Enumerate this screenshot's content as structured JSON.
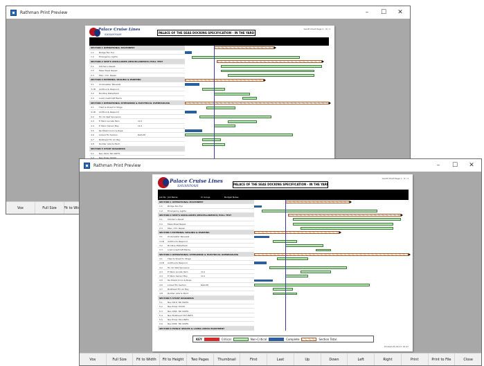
{
  "back_window": {
    "title": "Rathman Print Preview",
    "report_title": "PALACE OF THE SEAS  DOCKING SPECIFICATION - IN THE YARD",
    "page_label": "Gantt Chart Page 1 : 6 / 1",
    "buttons": [
      "Vox",
      "Full Size",
      "Fit to Width"
    ]
  },
  "front_window": {
    "title": "Rathman Print Preview",
    "report_title": "PALACE OF THE SEAS  DOCKING SPECIFICATION - IN THE YARD",
    "page_label": "Gantt Chart Page 1 : 6 / 1",
    "footer_page": "Printed 25-09-17  15:47",
    "buttons": [
      "Vox",
      "Full Size",
      "Fit to Width",
      "Fit to Height",
      "Two Pages",
      "Thumbnail",
      "First",
      "Last",
      "Up",
      "Down",
      "Left",
      "Right",
      "Print",
      "Print to File",
      "Close"
    ]
  },
  "window_controls": {
    "minimize": "–",
    "maximize": "☐",
    "close": "✕"
  },
  "logo": {
    "name": "Palace Cruise Lines",
    "sub": "SAVANNAH"
  },
  "columns": [
    "Job No",
    "Job Name",
    "Cr Group",
    "Budget Notes"
  ],
  "legend": {
    "key_label": "KEY",
    "items": [
      "Critical",
      "Non-Critical",
      "Complete",
      "Section Total"
    ]
  },
  "rows": [
    {
      "type": "sect",
      "no": "",
      "name": "SECTION 1 OPERATIONAL MACHINERY",
      "grp": ""
    },
    {
      "type": "row",
      "no": "1.1",
      "name": "Bridge Fan Fun",
      "grp": ""
    },
    {
      "type": "row",
      "no": "1.2",
      "name": "Emergency Lights",
      "grp": ""
    },
    {
      "type": "sect",
      "no": "",
      "name": "SECTION 2 SHIP'S ANCILLARIES (MISCELLANEOUS) HULL TEST",
      "grp": ""
    },
    {
      "type": "row",
      "no": "2.1",
      "name": "Kitchen's Resist",
      "grp": ""
    },
    {
      "type": "row",
      "no": "2.2",
      "name": "Mess Steel Repair",
      "grp": ""
    },
    {
      "type": "row",
      "no": "2.3",
      "name": "Misc. Ctrl. Repair",
      "grp": ""
    },
    {
      "type": "sect",
      "no": "",
      "name": "SECTION 3 EXTERNAL SEALING & PAINTING",
      "grp": ""
    },
    {
      "type": "row",
      "no": "3.1",
      "name": "Underwater Renewal",
      "grp": ""
    },
    {
      "type": "row",
      "no": "3.1B",
      "name": "Antifoul & Respond",
      "grp": ""
    },
    {
      "type": "row",
      "no": "3.2",
      "name": "Boottop Plate/Paint",
      "grp": ""
    },
    {
      "type": "row",
      "no": "3.3",
      "name": "Load Line/Draft Marks",
      "grp": ""
    },
    {
      "type": "sect",
      "no": "",
      "name": "SECTION 4 OPERATIONAL STEELWORK & ELECTRICAL OVERHAULING",
      "grp": ""
    },
    {
      "type": "row",
      "no": "4.1",
      "name": "Tiled & Sheet to Stage",
      "grp": ""
    },
    {
      "type": "row",
      "no": "4.1B",
      "name": "Antifoul & Respond",
      "grp": ""
    },
    {
      "type": "row",
      "no": "4.2",
      "name": "Fin On Wet Sponsons",
      "grp": ""
    },
    {
      "type": "row",
      "no": "4.3",
      "name": "E Stern Locate Item",
      "grp": "114"
    },
    {
      "type": "row",
      "no": "4.4",
      "name": "E Stern Sensor Bay",
      "grp": "114"
    },
    {
      "type": "row",
      "no": "4.5",
      "name": "Re Shield Conn & Rope",
      "grp": ""
    },
    {
      "type": "row",
      "no": "4.6",
      "name": "Linked Fin Section",
      "grp": "Retrofit"
    },
    {
      "type": "row",
      "no": "4.7",
      "name": "Bulkhead Fin Air Bay",
      "grp": ""
    },
    {
      "type": "row",
      "no": "4.8",
      "name": "Rudder Axle & Mech",
      "grp": ""
    },
    {
      "type": "sect",
      "no": "",
      "name": "SECTION 5 STUDY DIAGNOSIS",
      "grp": ""
    },
    {
      "type": "row",
      "no": "5.1",
      "name": "Nav P.R.P. TRI UNITS",
      "grp": ""
    },
    {
      "type": "row",
      "no": "5.2",
      "name": "Nav Emer HVCM",
      "grp": ""
    },
    {
      "type": "row",
      "no": "5.3",
      "name": "Nav P.P.B. TRI UNITS",
      "grp": ""
    },
    {
      "type": "row",
      "no": "5.4",
      "name": "Nav Bulkhead TRI UNITS",
      "grp": ""
    },
    {
      "type": "row",
      "no": "5.5",
      "name": "Nav Emer TRI UNITS",
      "grp": ""
    },
    {
      "type": "row",
      "no": "5.6",
      "name": "Nav P.P.B. TRI UNITS",
      "grp": ""
    },
    {
      "type": "sect",
      "no": "",
      "name": "SECTION 6 PUBLIC SPACES & LIVING AREAS EQUIPMENT",
      "grp": ""
    }
  ],
  "colors": {
    "critical": "#d62828",
    "non_critical": "#bfe5bb",
    "complete": "#2a5e9c",
    "section_total": "#f4cfb8",
    "window_bg": "#a8a8a8"
  }
}
